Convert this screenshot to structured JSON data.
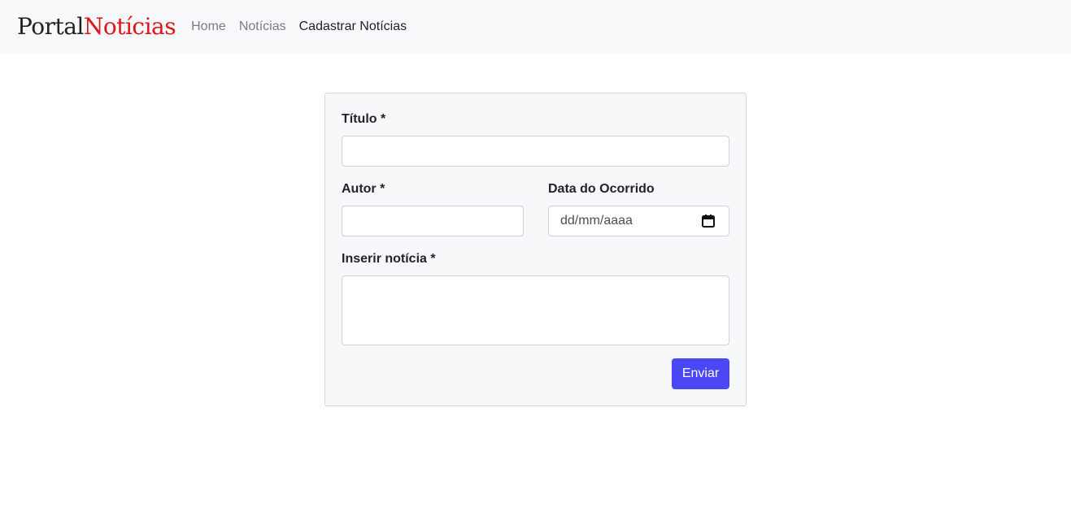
{
  "navbar": {
    "brand_part1": "Portal",
    "brand_part2": "Notícias",
    "links": [
      {
        "label": "Home"
      },
      {
        "label": "Notícias"
      },
      {
        "label": "Cadastrar Notícias"
      }
    ]
  },
  "form": {
    "titulo_label": "Título *",
    "titulo_value": "",
    "autor_label": "Autor *",
    "autor_value": "",
    "data_label": "Data do Ocorrido",
    "data_placeholder": "dd/mm/aaaa",
    "noticia_label": "Inserir notícia *",
    "noticia_value": "",
    "submit_label": "Enviar"
  },
  "colors": {
    "brand_accent": "#e0151c",
    "button": "#4a47f5",
    "navbar_bg": "#f8f9fa"
  }
}
